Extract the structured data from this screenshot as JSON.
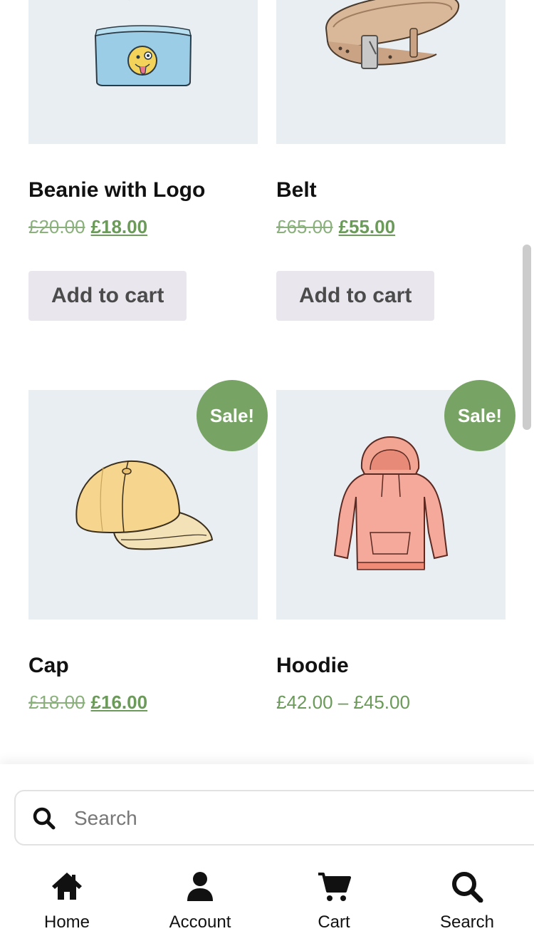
{
  "products": [
    {
      "title": "Beanie with Logo",
      "old_price": "£20.00",
      "new_price": "£18.00",
      "button": "Add to cart"
    },
    {
      "title": "Belt",
      "old_price": "£65.00",
      "new_price": "£55.00",
      "button": "Add to cart"
    },
    {
      "title": "Cap",
      "badge": "Sale!",
      "old_price": "£18.00",
      "new_price": "£16.00"
    },
    {
      "title": "Hoodie",
      "badge": "Sale!",
      "price_range": "£42.00 – £45.00"
    }
  ],
  "search": {
    "placeholder": "Search"
  },
  "nav": [
    {
      "label": "Home",
      "icon": "home-icon"
    },
    {
      "label": "Account",
      "icon": "user-icon"
    },
    {
      "label": "Cart",
      "icon": "cart-icon"
    },
    {
      "label": "Search",
      "icon": "search-icon"
    }
  ],
  "colors": {
    "accent": "#77a464",
    "image_bg": "#e9eef3",
    "button_bg": "#e9e6ed",
    "price_green": "#6b9a5a"
  }
}
